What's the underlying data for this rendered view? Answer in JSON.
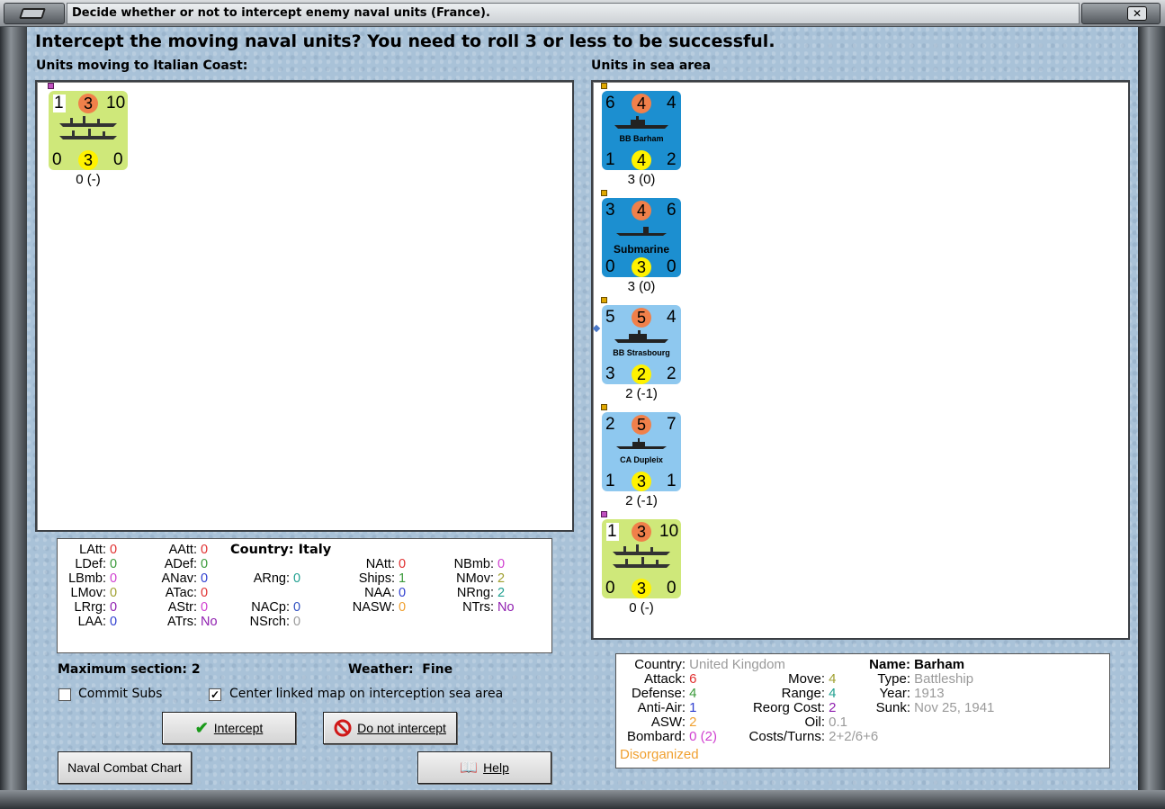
{
  "window": {
    "title": "Decide whether or not to intercept enemy naval units (France)."
  },
  "prompt": "Intercept the moving naval units?  You need to roll 3 or less to be successful.",
  "moving_panel": {
    "label": "Units moving to Italian Coast:",
    "units": [
      {
        "tl": "1",
        "tc": "3",
        "tr": "10",
        "bl": "0",
        "bc": "3",
        "br": "0",
        "name": "",
        "below": "0 (-)",
        "color": "green"
      }
    ]
  },
  "sea_panel": {
    "label": "Units in sea area",
    "units": [
      {
        "tl": "6",
        "tc": "4",
        "tr": "4",
        "bl": "1",
        "bc": "4",
        "br": "2",
        "name": "BB Barham",
        "below": "3 (0)",
        "color": "blue"
      },
      {
        "tl": "3",
        "tc": "4",
        "tr": "6",
        "bl": "0",
        "bc": "3",
        "br": "0",
        "name": "Submarine",
        "below": "3 (0)",
        "color": "blue"
      },
      {
        "tl": "5",
        "tc": "5",
        "tr": "4",
        "bl": "3",
        "bc": "2",
        "br": "2",
        "name": "BB Strasbourg",
        "below": "2 (-1)",
        "color": "lblue"
      },
      {
        "tl": "2",
        "tc": "5",
        "tr": "7",
        "bl": "1",
        "bc": "3",
        "br": "1",
        "name": "CA Dupleix",
        "below": "2 (-1)",
        "color": "lblue"
      },
      {
        "tl": "1",
        "tc": "3",
        "tr": "10",
        "bl": "0",
        "bc": "3",
        "br": "0",
        "name": "",
        "below": "0 (-)",
        "color": "green"
      }
    ]
  },
  "stats": {
    "country_label": "Country: Italy",
    "LAtt": "0",
    "LDef": "0",
    "LBmb": "0",
    "LMov": "0",
    "LRrg": "0",
    "LAA": "0",
    "AAtt": "0",
    "ADef": "0",
    "ANav": "0",
    "ATac": "0",
    "AStr": "0",
    "ATrs": "No",
    "ARng": "0",
    "NACp": "0",
    "NSrch": "0",
    "NAtt": "0",
    "Ships": "1",
    "NAA": "0",
    "NASW": "0",
    "NBmb": "0",
    "NMov": "2",
    "NRng": "2",
    "NTrs": "No"
  },
  "section": {
    "label": "Maximum section: 2"
  },
  "weather": {
    "label": "Weather:",
    "value": "Fine"
  },
  "commit_subs": {
    "label": "Commit Subs",
    "checked": ""
  },
  "center_map": {
    "label": "Center linked map on interception sea area",
    "checked": "✓"
  },
  "buttons": {
    "intercept": "Intercept",
    "do_not": "Do not intercept",
    "chart": "Naval Combat Chart",
    "help": "Help"
  },
  "info": {
    "country_k": "Country:",
    "country_v": "United Kingdom",
    "attack_k": "Attack:",
    "attack_v": "6",
    "defense_k": "Defense:",
    "defense_v": "4",
    "antiair_k": "Anti-Air:",
    "antiair_v": "1",
    "asw_k": "ASW:",
    "asw_v": "2",
    "bombard_k": "Bombard:",
    "bombard_v": "0 (2)",
    "move_k": "Move:",
    "move_v": "4",
    "range_k": "Range:",
    "range_v": "4",
    "reorg_k": "Reorg Cost:",
    "reorg_v": "2",
    "oil_k": "Oil:",
    "oil_v": "0.1",
    "costs_k": "Costs/Turns:",
    "costs_v": "2+2/6+6",
    "name_k": "Name:",
    "name_v": "Barham",
    "type_k": "Type:",
    "type_v": "Battleship",
    "year_k": "Year:",
    "year_v": "1913",
    "sunk_k": "Sunk:",
    "sunk_v": "Nov 25, 1941",
    "status": "Disorganized"
  }
}
